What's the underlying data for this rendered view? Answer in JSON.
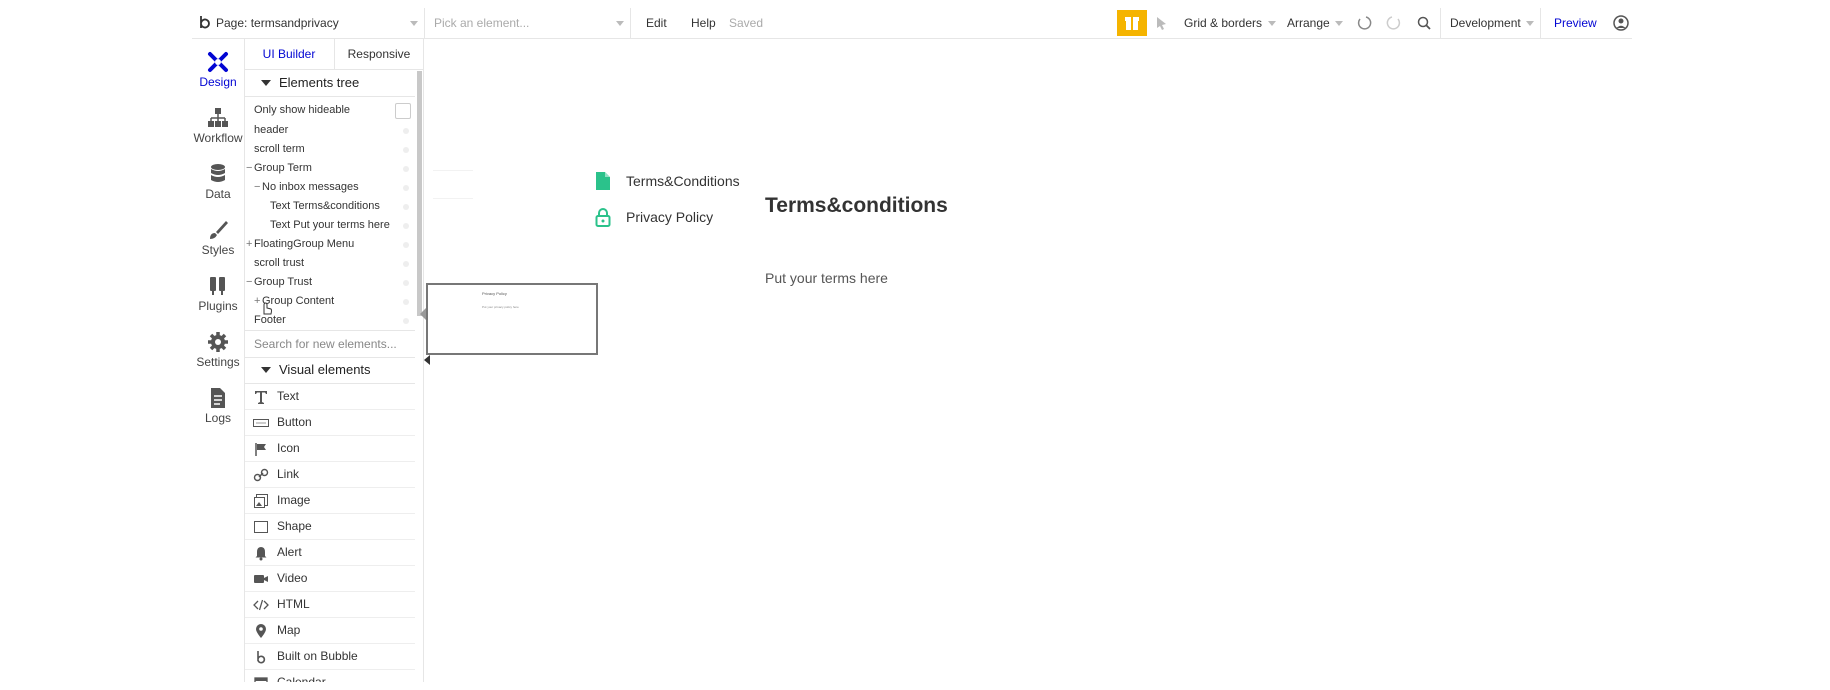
{
  "topbar": {
    "page_label": "Page: termsandprivacy",
    "element_picker_placeholder": "Pick an element...",
    "edit": "Edit",
    "help": "Help",
    "saved": "Saved",
    "grid_borders": "Grid & borders",
    "arrange": "Arrange",
    "environment": "Development",
    "preview": "Preview"
  },
  "rail": {
    "items": [
      {
        "label": "Design",
        "icon": "design-icon"
      },
      {
        "label": "Workflow",
        "icon": "workflow-icon"
      },
      {
        "label": "Data",
        "icon": "database-icon"
      },
      {
        "label": "Styles",
        "icon": "brush-icon"
      },
      {
        "label": "Plugins",
        "icon": "plug-icon"
      },
      {
        "label": "Settings",
        "icon": "gear-icon"
      },
      {
        "label": "Logs",
        "icon": "document-icon"
      }
    ]
  },
  "panel": {
    "tabs": [
      "UI Builder",
      "Responsive"
    ],
    "elements_tree_title": "Elements tree",
    "only_show_hideable": "Only show hideable",
    "tree": [
      {
        "label": "header"
      },
      {
        "label": "scroll term"
      },
      {
        "label": "Group Term",
        "toggle": "−"
      },
      {
        "label": "No inbox messages",
        "toggle": "−"
      },
      {
        "label": "Text Terms&conditions"
      },
      {
        "label": "Text Put your terms here"
      },
      {
        "label": "FloatingGroup Menu",
        "toggle": "+"
      },
      {
        "label": "scroll trust"
      },
      {
        "label": "Group Trust",
        "toggle": "−"
      },
      {
        "label": "Group Content",
        "toggle": "+"
      },
      {
        "label": "Footer"
      }
    ],
    "search_placeholder": "Search for new elements...",
    "visual_elements_title": "Visual elements",
    "visual_elements": [
      {
        "label": "Text",
        "icon": "text-icon"
      },
      {
        "label": "Button",
        "icon": "button-icon"
      },
      {
        "label": "Icon",
        "icon": "flag-icon"
      },
      {
        "label": "Link",
        "icon": "link-icon"
      },
      {
        "label": "Image",
        "icon": "image-icon"
      },
      {
        "label": "Shape",
        "icon": "shape-icon"
      },
      {
        "label": "Alert",
        "icon": "bell-icon"
      },
      {
        "label": "Video",
        "icon": "video-icon"
      },
      {
        "label": "HTML",
        "icon": "code-icon"
      },
      {
        "label": "Map",
        "icon": "map-pin-icon"
      },
      {
        "label": "Built on Bubble",
        "icon": "bubble-logo-icon"
      },
      {
        "label": "Calendar",
        "icon": "calendar-icon"
      }
    ]
  },
  "canvas": {
    "menu": [
      {
        "label": "Terms&Conditions",
        "icon": "document-icon"
      },
      {
        "label": "Privacy Policy",
        "icon": "lock-icon"
      }
    ],
    "heading": "Terms&conditions",
    "body": "Put your terms here",
    "preview_title": "Privacy Policy",
    "preview_body": "Put your privacy policy here"
  },
  "colors": {
    "accent": "#0205d3",
    "brand_green": "#2bc28b",
    "gift": "#f5b400"
  }
}
